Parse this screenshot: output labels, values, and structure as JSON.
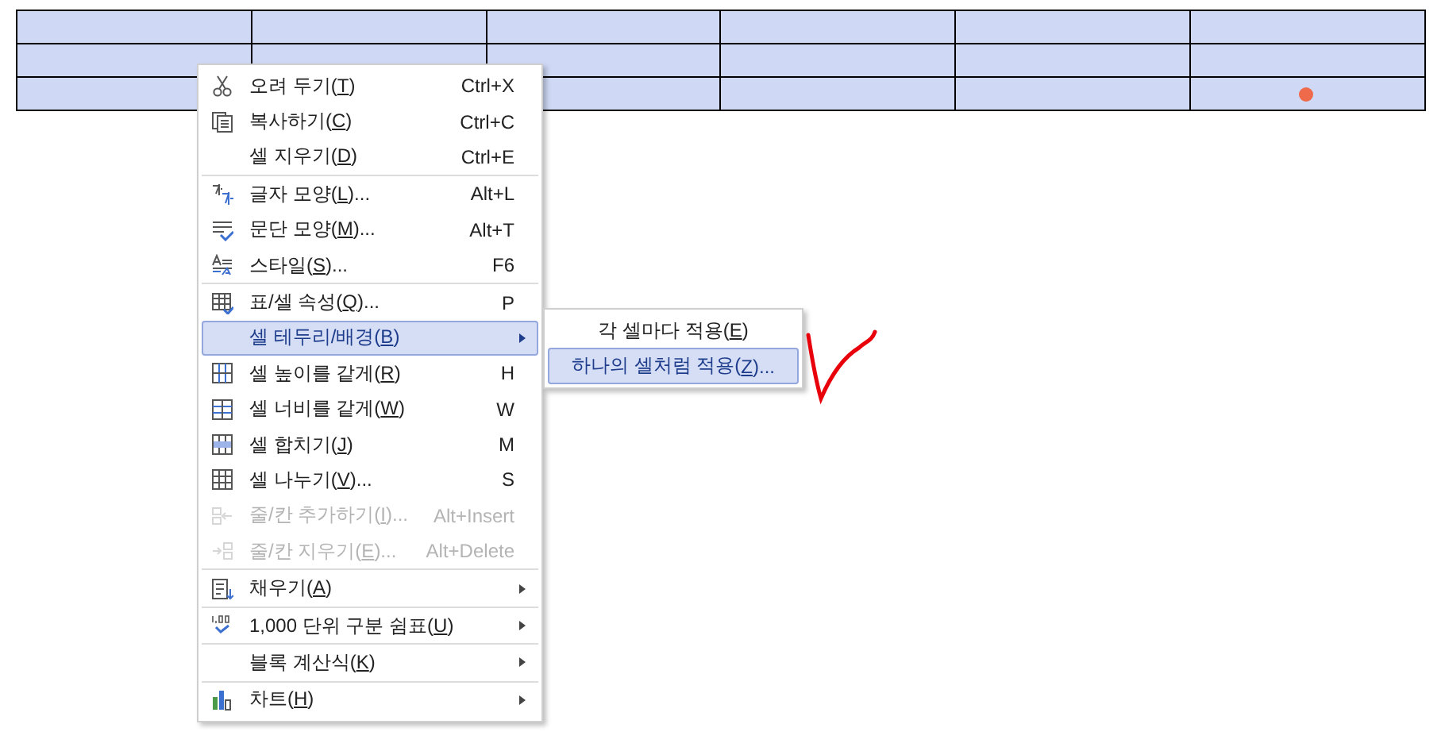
{
  "table": {
    "selected": true,
    "rows": [
      {
        "cells": [
          {},
          {},
          {},
          {},
          {},
          {}
        ]
      },
      {
        "cells": [
          {},
          {},
          {},
          {},
          {},
          {}
        ]
      },
      {
        "cells": [
          {},
          {},
          {},
          {},
          {},
          {
            "dot": true
          }
        ]
      }
    ]
  },
  "context_menu": {
    "groups": [
      [
        {
          "label": "오려 두기(T)",
          "shortcut": "Ctrl+X",
          "selected": false,
          "disabled": false,
          "submenu": false
        },
        {
          "label": "복사하기(C)",
          "shortcut": "Ctrl+C",
          "selected": false,
          "disabled": false,
          "submenu": false
        },
        {
          "label": "셀 지우기(D)",
          "shortcut": "Ctrl+E",
          "selected": false,
          "disabled": false,
          "submenu": false
        }
      ],
      [
        {
          "label": "글자 모양(L)...",
          "shortcut": "Alt+L",
          "selected": false,
          "disabled": false,
          "submenu": false
        },
        {
          "label": "문단 모양(M)...",
          "shortcut": "Alt+T",
          "selected": false,
          "disabled": false,
          "submenu": false
        },
        {
          "label": "스타일(S)...",
          "shortcut": "F6",
          "selected": false,
          "disabled": false,
          "submenu": false
        }
      ],
      [
        {
          "label": "표/셀 속성(Q)...",
          "shortcut": "P",
          "selected": false,
          "disabled": false,
          "submenu": false
        },
        {
          "label": "셀 테두리/배경(B)",
          "selected": true,
          "disabled": false,
          "submenu": true
        },
        {
          "label": "셀 높이를 같게(R)",
          "shortcut": "H",
          "selected": false,
          "disabled": false,
          "submenu": false
        },
        {
          "label": "셀 너비를 같게(W)",
          "shortcut": "W",
          "selected": false,
          "disabled": false,
          "submenu": false
        },
        {
          "label": "셀 합치기(J)",
          "shortcut": "M",
          "selected": false,
          "disabled": false,
          "submenu": false
        },
        {
          "label": "셀 나누기(V)...",
          "shortcut": "S",
          "selected": false,
          "disabled": false,
          "submenu": false
        },
        {
          "label": "줄/칸 추가하기(I)...",
          "shortcut": "Alt+Insert",
          "selected": false,
          "disabled": true,
          "submenu": false
        },
        {
          "label": "줄/칸 지우기(E)...",
          "shortcut": "Alt+Delete",
          "selected": false,
          "disabled": true,
          "submenu": false
        }
      ],
      [
        {
          "label": "채우기(A)",
          "selected": false,
          "disabled": false,
          "submenu": true
        }
      ],
      [
        {
          "label": "1,000 단위 구분 쉼표(U)",
          "selected": false,
          "disabled": false,
          "submenu": true
        }
      ],
      [
        {
          "label": "블록 계산식(K)",
          "selected": false,
          "disabled": false,
          "submenu": true
        }
      ],
      [
        {
          "label": "차트(H)",
          "selected": false,
          "disabled": false,
          "submenu": true
        }
      ]
    ]
  },
  "submenu": {
    "items": [
      {
        "label": "각 셀마다 적용(E)",
        "selected": false
      },
      {
        "label": "하나의 셀처럼 적용(Z)...",
        "selected": true
      }
    ]
  }
}
